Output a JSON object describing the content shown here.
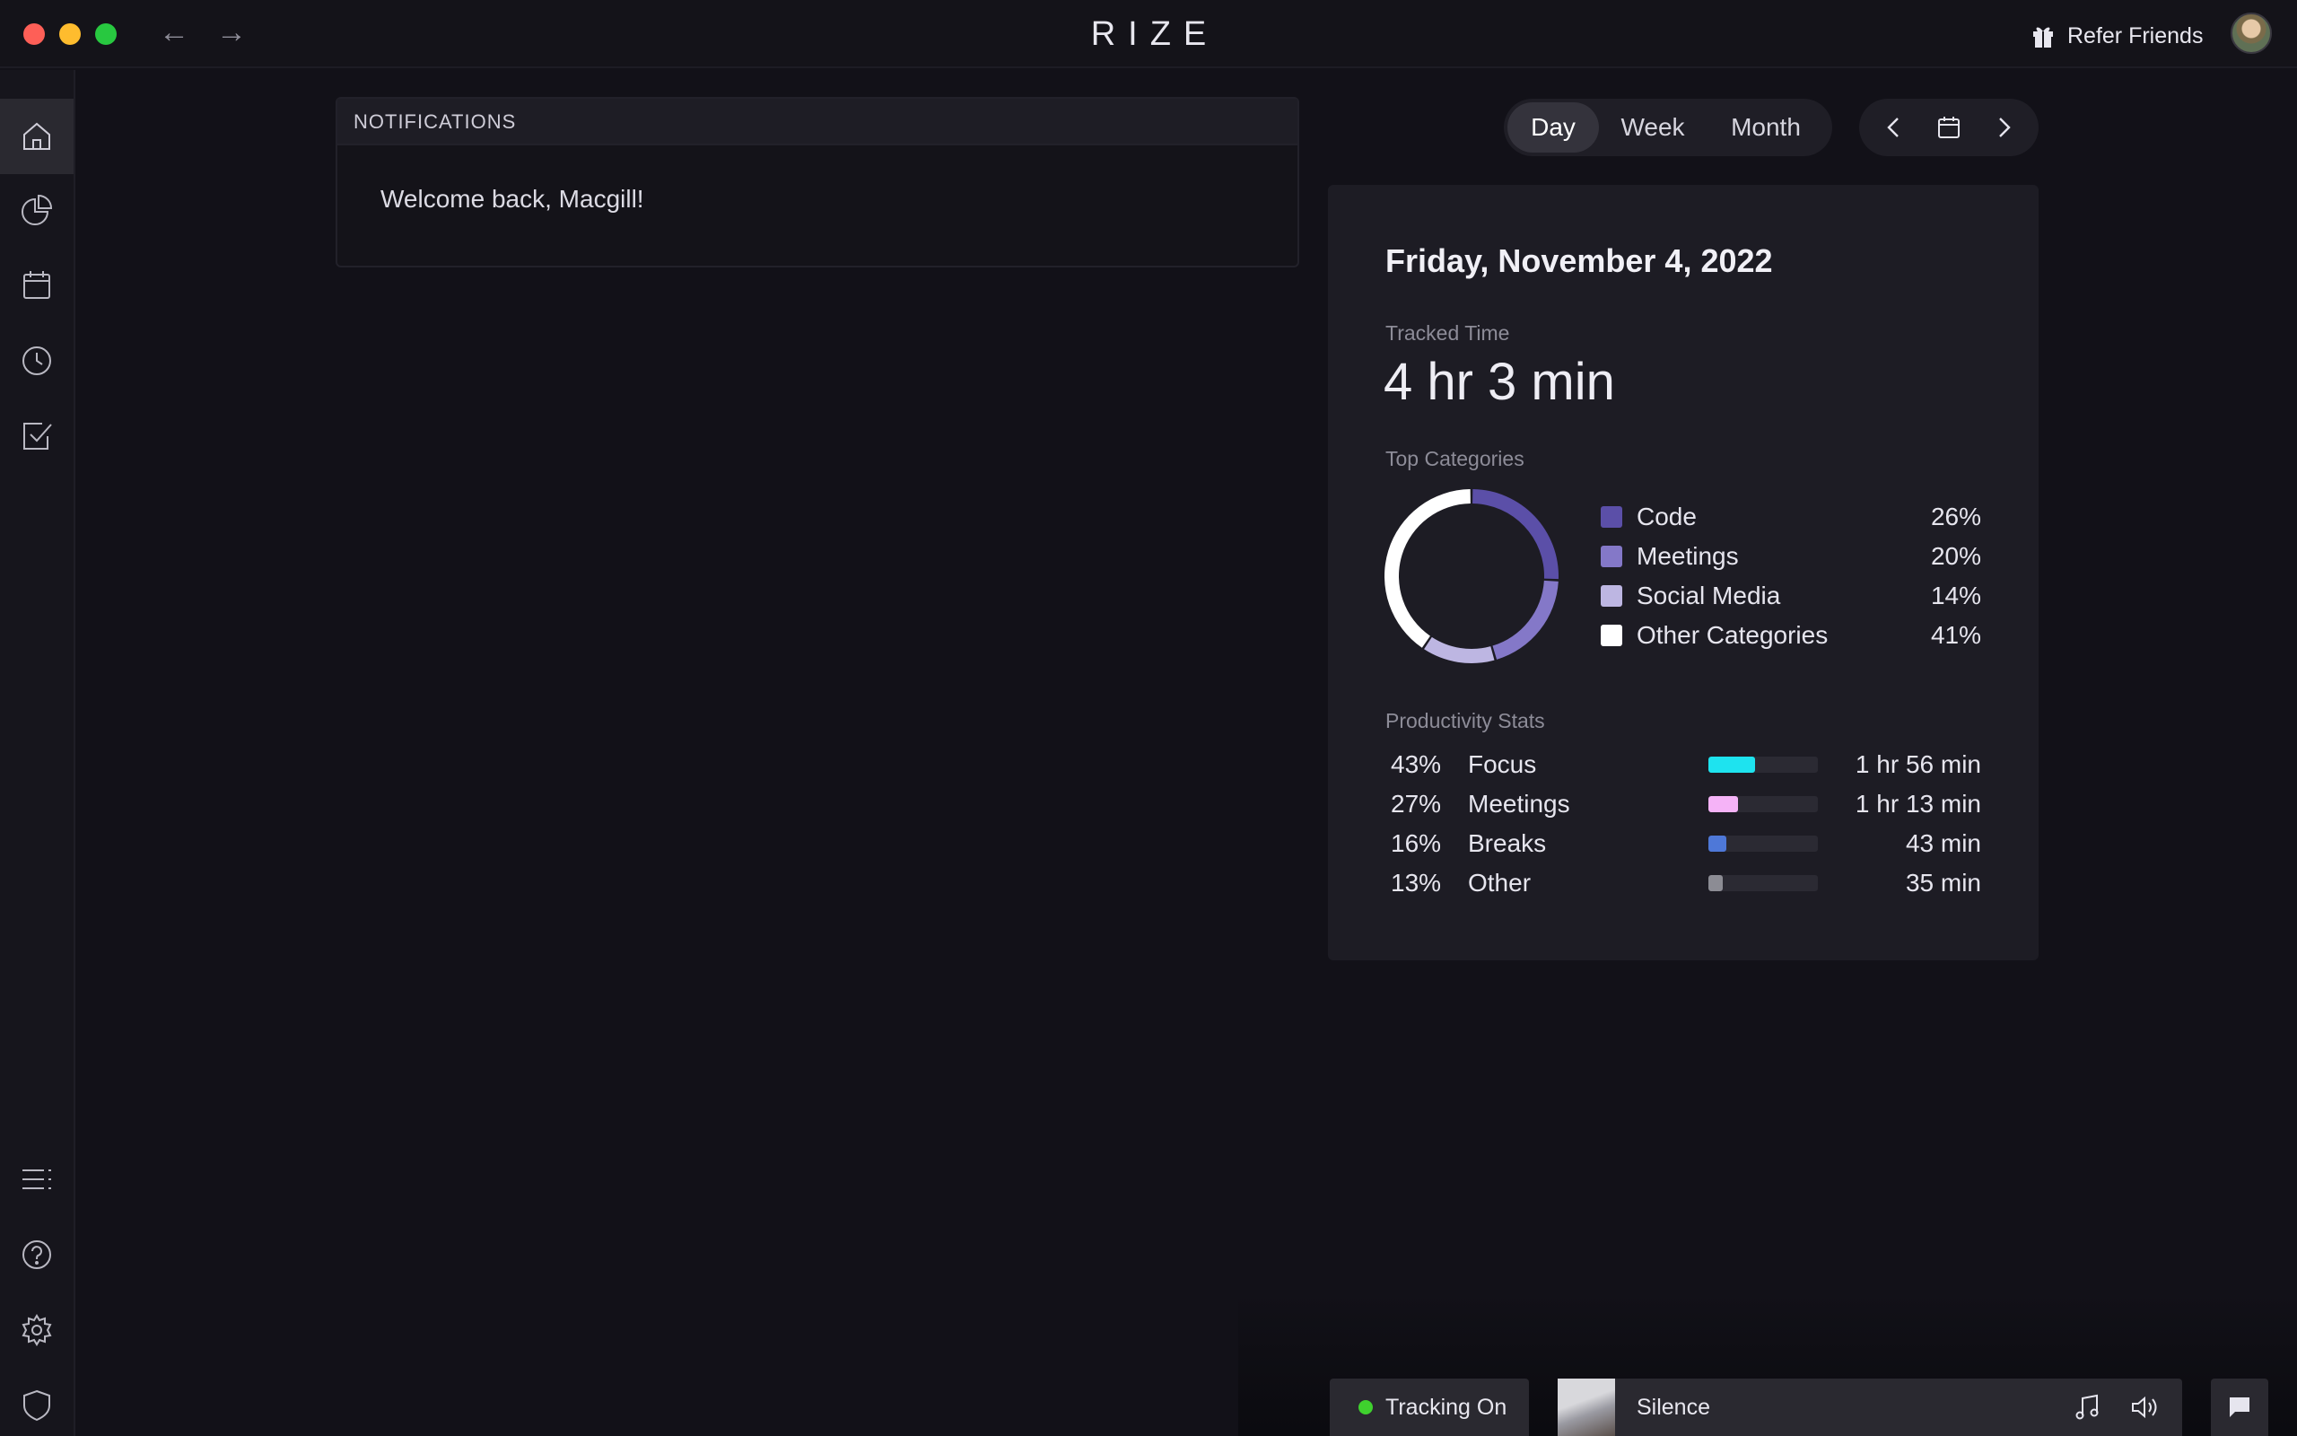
{
  "app": {
    "logo": "RIZE"
  },
  "titlebar": {
    "back_label": "←",
    "forward_label": "→",
    "refer_label": "Refer Friends"
  },
  "sidebar": {
    "top_items": [
      {
        "name": "home",
        "icon": "home-icon",
        "active": true
      },
      {
        "name": "reports",
        "icon": "pie-chart-icon",
        "active": false
      },
      {
        "name": "calendar",
        "icon": "calendar-icon",
        "active": false
      },
      {
        "name": "timeline",
        "icon": "clock-icon",
        "active": false
      },
      {
        "name": "tasks",
        "icon": "checkbox-icon",
        "active": false
      }
    ],
    "bottom_items": [
      {
        "name": "list",
        "icon": "list-icon"
      },
      {
        "name": "help",
        "icon": "help-icon"
      },
      {
        "name": "settings",
        "icon": "gear-icon"
      },
      {
        "name": "privacy",
        "icon": "shield-icon"
      }
    ]
  },
  "notifications": {
    "header": "NOTIFICATIONS",
    "message": "Welcome back, Macgill!"
  },
  "period": {
    "options": [
      "Day",
      "Week",
      "Month"
    ],
    "selected": "Day"
  },
  "summary": {
    "date": "Friday, November 4, 2022",
    "tracked_label": "Tracked Time",
    "tracked_value": "4 hr 3 min",
    "categories_label": "Top Categories",
    "categories": [
      {
        "name": "Code",
        "pct_label": "26%",
        "pct": 26,
        "color": "#5b4fa8"
      },
      {
        "name": "Meetings",
        "pct_label": "20%",
        "pct": 20,
        "color": "#8478c8"
      },
      {
        "name": "Social Media",
        "pct_label": "14%",
        "pct": 14,
        "color": "#bdb6e2"
      },
      {
        "name": "Other Categories",
        "pct_label": "41%",
        "pct": 41,
        "color": "#ffffff"
      }
    ],
    "productivity_label": "Productivity Stats",
    "productivity": [
      {
        "pct_label": "43%",
        "name": "Focus",
        "duration": "1 hr 56 min",
        "fraction": 0.43,
        "color": "#1ee3ef"
      },
      {
        "pct_label": "27%",
        "name": "Meetings",
        "duration": "1 hr 13 min",
        "fraction": 0.27,
        "color": "#f5b3f7"
      },
      {
        "pct_label": "16%",
        "name": "Breaks",
        "duration": "43 min",
        "fraction": 0.16,
        "color": "#4e78d8"
      },
      {
        "pct_label": "13%",
        "name": "Other",
        "duration": "35 min",
        "fraction": 0.13,
        "color": "#8c8c94"
      }
    ]
  },
  "bottombar": {
    "tracking_label": "Tracking On",
    "tracking_color": "#3fd12e",
    "track_name": "Silence"
  }
}
